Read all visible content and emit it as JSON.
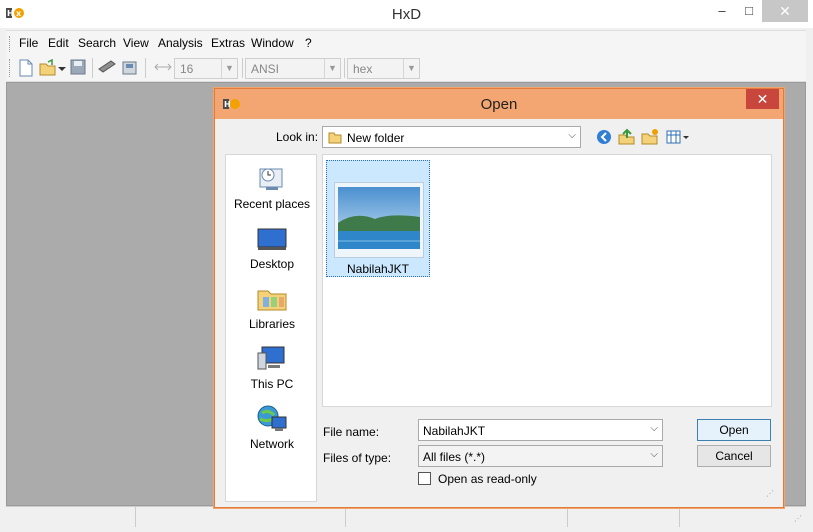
{
  "app": {
    "title": "HxD",
    "icon_text": "HxD",
    "window_controls": {
      "minimize": "–",
      "maximize": "□",
      "close": "✕"
    }
  },
  "menubar": {
    "items": [
      "File",
      "Edit",
      "Search",
      "View",
      "Analysis",
      "Extras",
      "Window",
      "?"
    ]
  },
  "toolbar": {
    "bytes_per_row": "16",
    "charset": "ANSI",
    "offset_base": "hex"
  },
  "dialog": {
    "title": "Open",
    "icon_text": "HxD",
    "close": "✕",
    "look_in_label": "Look in:",
    "look_in_value": "New folder",
    "places": [
      {
        "label": "Recent places",
        "icon": "recent-places-icon"
      },
      {
        "label": "Desktop",
        "icon": "desktop-icon"
      },
      {
        "label": "Libraries",
        "icon": "libraries-icon"
      },
      {
        "label": "This PC",
        "icon": "this-pc-icon"
      },
      {
        "label": "Network",
        "icon": "network-icon"
      }
    ],
    "files": [
      {
        "name": "NabilahJKT",
        "selected": true,
        "icon": "image-thumbnail"
      }
    ],
    "file_name_label": "File name:",
    "file_name_value": "NabilahJKT",
    "file_type_label": "Files of type:",
    "file_type_value": "All files (*.*)",
    "read_only_label": "Open as read-only",
    "read_only_checked": false,
    "open_button": "Open",
    "cancel_button": "Cancel"
  },
  "colors": {
    "dialog_title_bg": "#f4a672",
    "dialog_border": "#e07b3c",
    "selection_bg": "#cce8ff",
    "workspace_bg": "#ababab"
  }
}
